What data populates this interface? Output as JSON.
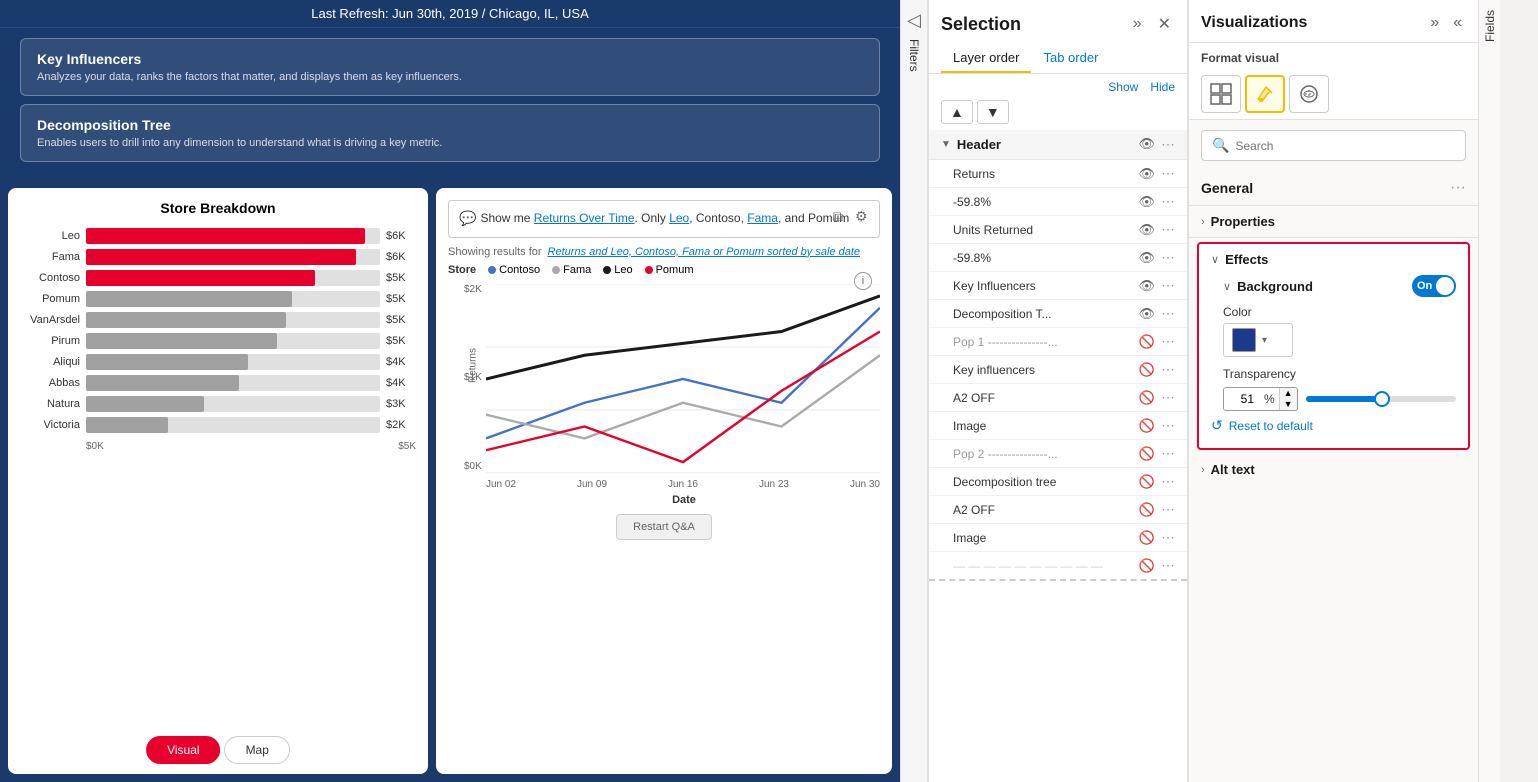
{
  "header": {
    "last_refresh": "Last Refresh: Jun 30th, 2019 / Chicago, IL, USA"
  },
  "viz_options": [
    {
      "title": "Key Influencers",
      "description": "Analyzes your data, ranks the factors that matter, and displays them as key influencers."
    },
    {
      "title": "Decomposition Tree",
      "description": "Enables users to drill into any dimension to understand what is driving a key metric."
    }
  ],
  "store_breakdown": {
    "title": "Store Breakdown",
    "bars": [
      {
        "label": "Leo",
        "value": "$6K",
        "pct": 95,
        "red": true
      },
      {
        "label": "Fama",
        "value": "$6K",
        "pct": 92,
        "red": true
      },
      {
        "label": "Contoso",
        "value": "$5K",
        "pct": 78,
        "red": true
      },
      {
        "label": "Pomum",
        "value": "$5K",
        "pct": 70,
        "red": false
      },
      {
        "label": "VanArsdel",
        "value": "$5K",
        "pct": 68,
        "red": false
      },
      {
        "label": "Pirum",
        "value": "$5K",
        "pct": 65,
        "red": false
      },
      {
        "label": "Aliqui",
        "value": "$4K",
        "pct": 55,
        "red": false
      },
      {
        "label": "Abbas",
        "value": "$4K",
        "pct": 52,
        "red": false
      },
      {
        "label": "Natura",
        "value": "$3K",
        "pct": 40,
        "red": false
      },
      {
        "label": "Victoria",
        "value": "$2K",
        "pct": 28,
        "red": false
      }
    ],
    "x_labels": [
      "$0K",
      "$5K"
    ],
    "tabs": [
      "Visual",
      "Map"
    ]
  },
  "qa_chart": {
    "query": "Show me Returns Over Time. Only Leo, Contoso, Fama, and Pomum",
    "query_highlight1": "Leo",
    "query_highlight2": "Contoso",
    "query_highlight3": "Fama",
    "query_highlight4": "and Pomum",
    "showing_label": "Showing results for",
    "results_link": "Returns and Leo, Contoso, Fama or Pomum sorted by sale date",
    "store_label": "Store",
    "legend": [
      {
        "label": "Contoso",
        "color": "#4472c4"
      },
      {
        "label": "Fama",
        "color": "#aaaaaa"
      },
      {
        "label": "Leo",
        "color": "#1a1a1a"
      },
      {
        "label": "Pomum",
        "color": "#e8002d"
      }
    ],
    "y_ticks": [
      "$2K",
      "$1K",
      "$0K"
    ],
    "x_ticks": [
      "Jun 02",
      "Jun 09",
      "Jun 16",
      "Jun 23",
      "Jun 30"
    ],
    "x_label": "Date",
    "y_label": "Returns",
    "restart_btn": "Restart Q&A",
    "info_icon": "i"
  },
  "selection": {
    "title": "Selection",
    "tabs": [
      "Layer order",
      "Tab order"
    ],
    "show_btn": "Show",
    "hide_btn": "Hide",
    "move_up": "▲",
    "move_down": "▼",
    "group_header": "Header",
    "layers": [
      {
        "name": "Returns",
        "visible": true
      },
      {
        "name": "-59.8%",
        "visible": true
      },
      {
        "name": "Units Returned",
        "visible": true
      },
      {
        "name": "-59.8%",
        "visible": true
      },
      {
        "name": "Key Influencers",
        "visible": true
      },
      {
        "name": "Decomposition T...",
        "visible": true
      }
    ],
    "layers2": [
      {
        "name": "Pop 1 ---------------...",
        "visible": false,
        "dashed": true
      },
      {
        "name": "Key influencers",
        "visible": false
      },
      {
        "name": "A2 OFF",
        "visible": false
      },
      {
        "name": "Image",
        "visible": false
      },
      {
        "name": "Pop 2 ---------------...",
        "visible": false,
        "dashed": true
      },
      {
        "name": "Decomposition tree",
        "visible": false
      },
      {
        "name": "A2 OFF",
        "visible": false
      },
      {
        "name": "Image",
        "visible": false
      }
    ]
  },
  "visualizations": {
    "title": "Visualizations",
    "expand_icon": "»",
    "collapse_icon": "«",
    "format_visual_label": "Format visual",
    "viz_types": [
      "⊞",
      "✏",
      "☁"
    ],
    "search_placeholder": "Search",
    "general_label": "General",
    "general_dots": "···",
    "properties_label": "Properties",
    "effects_label": "Effects",
    "background_label": "Background",
    "toggle_state": "On",
    "color_label": "Color",
    "color_hex": "#1a3a8b",
    "transparency_label": "Transparency",
    "transparency_value": "51",
    "transparency_unit": "%",
    "reset_label": "Reset to default",
    "alt_text_label": "Alt text",
    "fields_tab": "Fields"
  },
  "filters_tab": "Filters"
}
